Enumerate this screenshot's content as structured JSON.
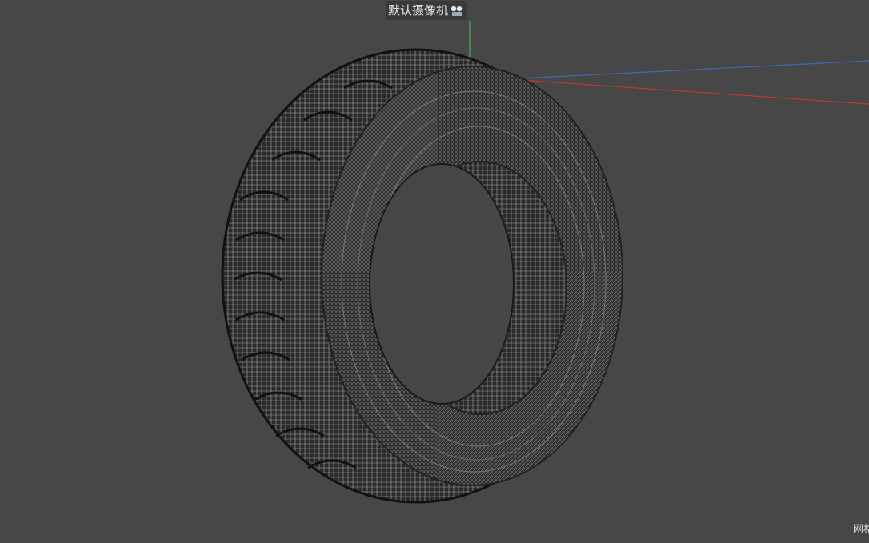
{
  "viewport": {
    "camera_name": "默认摄像机",
    "camera_icon": "camera-icon",
    "corner_text": "网格",
    "colors": {
      "background": "#474747",
      "axis_y": "#4caf50",
      "axis_x": "#c0392b",
      "axis_z": "#3a6ab5",
      "wire": "#9a9a9a",
      "mesh_fill": "#2a2a2a"
    }
  }
}
